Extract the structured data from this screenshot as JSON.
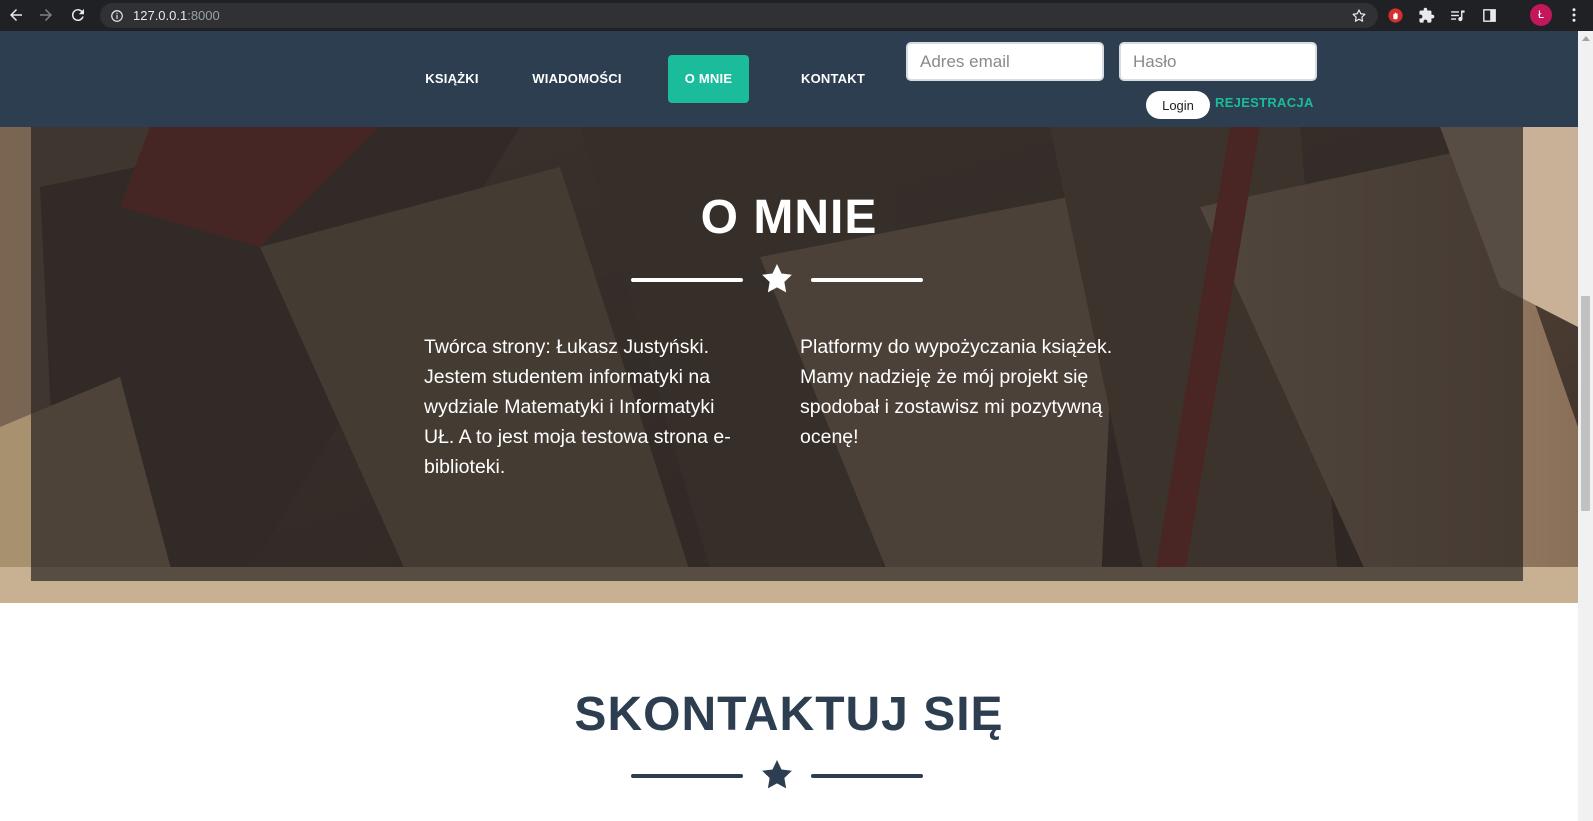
{
  "browser": {
    "url_host": "127.0.0.1",
    "url_port": ":8000",
    "profile_initial": "Ł"
  },
  "header": {
    "menu": [
      {
        "label": "KSIĄŻKI"
      },
      {
        "label": "WIADOMOŚCI"
      },
      {
        "label": "O MNIE",
        "active": true
      },
      {
        "label": "KONTAKT"
      }
    ],
    "email_placeholder": "Adres email",
    "password_placeholder": "Hasło",
    "login_label": "Login",
    "register_label": "REJESTRACJA"
  },
  "about": {
    "title": "O MNIE",
    "col_left": "Twórca strony: Łukasz Justyński. Jestem studentem informatyki na wydziale Matematyki i Informatyki UŁ. A to jest moja testowa strona e-biblioteki.",
    "col_right": "Platformy do wypożyczania książek. Mamy nadzieję że mój projekt się spodobał i zostawisz mi pozytywną ocenę!"
  },
  "contact": {
    "title": "SKONTAKTUJ SIĘ"
  },
  "colors": {
    "header_bg": "#2c3e50",
    "accent": "#1abc9c",
    "contact_title": "#2c3e50"
  }
}
